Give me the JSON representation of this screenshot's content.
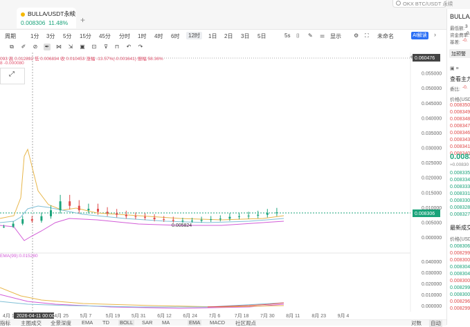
{
  "tab": {
    "name": "BULLA/USDT永续",
    "price": "0.008306",
    "change": "11.48%"
  },
  "search": {
    "placeholder": "OKX BTC/USDT 永续"
  },
  "timeframes": [
    "周期",
    "1分",
    "3分",
    "5分",
    "15分",
    "45分",
    "分时",
    "1时",
    "4时",
    "6时",
    "12时",
    "1日",
    "2日",
    "3日",
    "5日"
  ],
  "selected_timeframe": "12时",
  "toolbar_right": {
    "s5": "5s",
    "display": "显示",
    "unnamed": "未命名",
    "ai": "AI解读"
  },
  "info_line": "093 高 0.012892 低 0.006834 收 0.010453 涨幅 -13.57%(-0.001641) 振幅 58.36%",
  "info_line2": "8  -0.000080",
  "ema_label": "EMA(99):0.015280",
  "price_axis": [
    "0.060000",
    "0.055000",
    "0.050000",
    "0.045000",
    "0.040000",
    "0.035000",
    "0.030000",
    "0.025000",
    "0.020000",
    "0.015000",
    "0.010000",
    "0.005000",
    "0.000000"
  ],
  "top_price_tag": "0.060476",
  "current_price_tag": "0.008306",
  "low_marker": "0.005824",
  "sub_axis": [
    "0.040000",
    "0.030000",
    "0.020000",
    "0.010000",
    "0.000000"
  ],
  "date_axis": [
    "4月 1",
    "4月 13",
    "4月 25",
    "5月 7",
    "5月 19",
    "5月 31",
    "6月 12",
    "6月 24",
    "7月 6",
    "7月 18",
    "7月 30",
    "8月 11",
    "8月 23",
    "9月 4"
  ],
  "crosshair_date": "2026-04-11 00:00",
  "bottom_tabs": [
    "指标",
    "主图成交",
    "全景深度",
    "EMA",
    "TD",
    "BOLL",
    "SAR",
    "MA",
    "EMA",
    "MACD",
    "社区观点",
    "对数",
    "自动"
  ],
  "right_panel": {
    "title": "BULLA/",
    "rows": [
      "最低额:",
      "资金费率:",
      "基差:"
    ],
    "vals": [
      "3",
      "0.",
      "-0."
    ],
    "add_btn": "加预警",
    "main_force": "查看主力",
    "ratio_label": "委比:",
    "ratio_val": "-0.",
    "price_head": "价格(USD",
    "asks": [
      "0.008350",
      "0.008349",
      "0.008348",
      "0.008347",
      "0.008346",
      "0.008343",
      "0.008341",
      "0.008340"
    ],
    "mid": "0.0083",
    "mid_sub": "≈0.00830",
    "bids": [
      "0.008335",
      "0.008334",
      "0.008333",
      "0.008331",
      "0.008330",
      "0.008328",
      "0.008327"
    ],
    "trades_head": "最新成交",
    "trades_price_head": "价格(USD",
    "trades": [
      "0.008306",
      "0.008299",
      "0.008300",
      "0.008304",
      "0.008304",
      "0.008300",
      "0.008299",
      "0.008300",
      "0.008296",
      "0.008299"
    ],
    "trade_colors": [
      "g",
      "r",
      "r",
      "g",
      "g",
      "r",
      "g",
      "g",
      "r",
      "r"
    ]
  },
  "chart_data": {
    "type": "candlestick",
    "series": [
      {
        "name": "price",
        "values": [
          0.0035,
          0.0045,
          0.006,
          0.0055,
          0.007,
          0.009,
          0.012,
          0.0105,
          0.009,
          0.0095,
          0.0085,
          0.008,
          0.0075,
          0.007,
          0.0068,
          0.0065,
          0.006,
          0.0058,
          0.0055,
          0.0055,
          0.0055,
          0.0058,
          0.006,
          0.0062,
          0.0068,
          0.007,
          0.0072,
          0.0075,
          0.008,
          0.0083
        ]
      },
      {
        "name": "EMA(99)",
        "values": [
          0.015,
          0.0145,
          0.013,
          0.011,
          0.0095,
          0.0085,
          0.0078,
          0.0072,
          0.0068,
          0.0065,
          0.0062,
          0.006,
          0.0059,
          0.0058,
          0.0058
        ]
      }
    ],
    "ylim": [
      0,
      0.06
    ],
    "sub_ylim": [
      0,
      0.04
    ]
  }
}
